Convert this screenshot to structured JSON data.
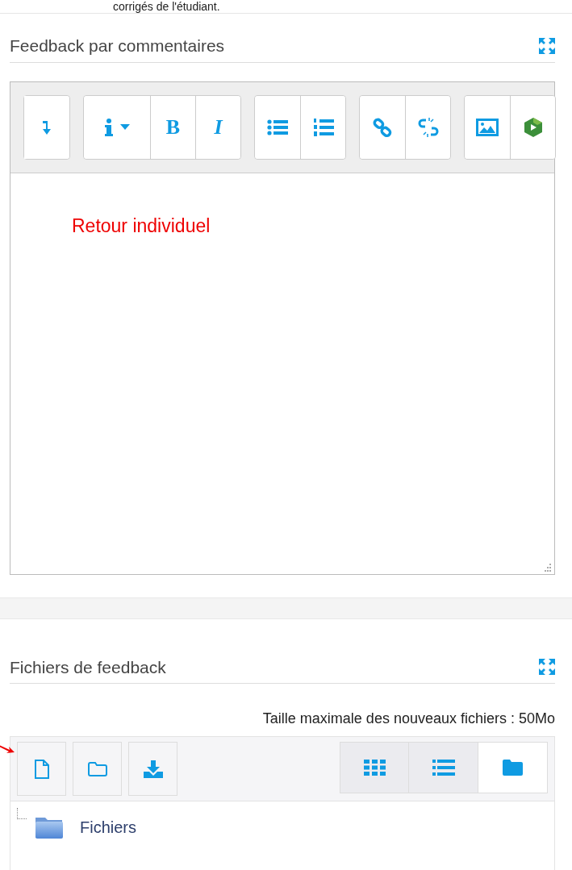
{
  "intro_text": "corrigés de l'étudiant.",
  "comment_section": {
    "title": "Feedback par commentaires",
    "toolbar_groups": [
      [
        {
          "kind": "collapse"
        }
      ],
      [
        {
          "kind": "info"
        },
        {
          "label": "B",
          "kind": "bold"
        },
        {
          "label": "I",
          "kind": "italic"
        }
      ],
      [
        {
          "kind": "bullets"
        },
        {
          "kind": "numbers"
        }
      ],
      [
        {
          "kind": "link"
        },
        {
          "kind": "unlink"
        }
      ],
      [
        {
          "kind": "image"
        },
        {
          "kind": "media"
        }
      ]
    ],
    "content": "Retour individuel"
  },
  "files_section": {
    "title": "Fichiers de feedback",
    "max_size": "Taille maximale des nouveaux fichiers : 50Mo",
    "actions": [
      {
        "kind": "file"
      },
      {
        "kind": "folder"
      },
      {
        "kind": "download"
      }
    ],
    "views": [
      {
        "kind": "grid",
        "selected": false
      },
      {
        "kind": "list",
        "selected": false
      },
      {
        "kind": "tree",
        "selected": true
      }
    ],
    "tree": [
      {
        "label": "Fichiers"
      }
    ]
  }
}
